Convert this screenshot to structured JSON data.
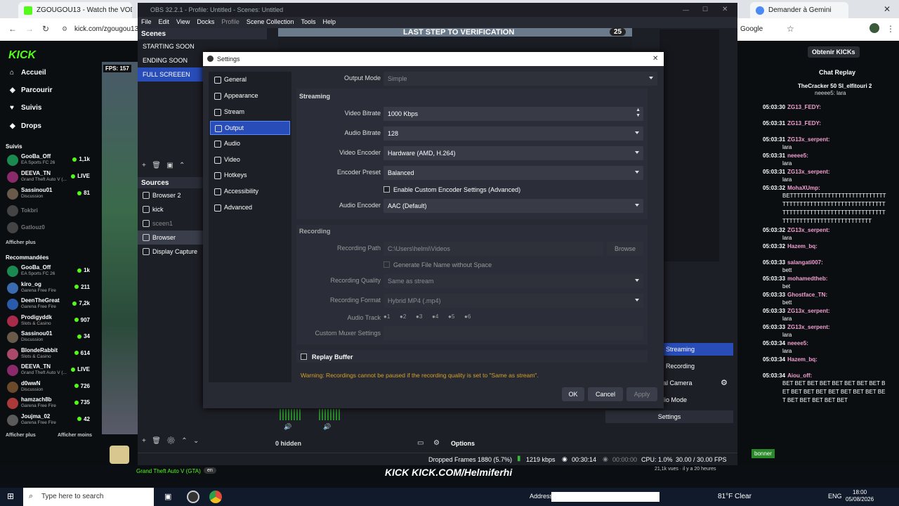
{
  "browser": {
    "tabs": [
      "ZGOUGOU13 - Watch the VOD",
      "Demander à Gemini"
    ],
    "url": "kick.com/zgougou13",
    "google_label": "Google",
    "obtain_label": "Obtenir KICKs"
  },
  "kick": {
    "logo": "KICK",
    "nav": [
      "Accueil",
      "Parcourir",
      "Suivis",
      "Drops"
    ],
    "followed_title": "Suivis",
    "followed": [
      {
        "name": "GooBa_Off",
        "game": "EA Sports FC 26",
        "viewers": "1,1k",
        "color": "#1a8a50"
      },
      {
        "name": "DEEVA_TN",
        "game": "Grand Theft Auto V (...",
        "viewers": "LIVE",
        "color": "#8a2a6a"
      },
      {
        "name": "Sassinou01",
        "game": "Discussion",
        "viewers": "81",
        "color": "#6a5a4a"
      },
      {
        "name": "Tokbri",
        "game": "",
        "viewers": "",
        "color": "#444"
      },
      {
        "name": "Gatlouz0",
        "game": "",
        "viewers": "",
        "color": "#444"
      }
    ],
    "show_more": "Afficher plus",
    "recommended_title": "Recommandées",
    "recommended": [
      {
        "name": "GooBa_Off",
        "game": "EA Sports FC 26",
        "viewers": "1k",
        "color": "#1a8a50"
      },
      {
        "name": "kiro_og",
        "game": "Garena Free Fire",
        "viewers": "211",
        "color": "#3a6ab0"
      },
      {
        "name": "DeenTheGreat",
        "game": "Garena Free Fire",
        "viewers": "7,2k",
        "color": "#2a5aaa"
      },
      {
        "name": "Prodigyddk",
        "game": "Slots & Casino",
        "viewers": "907",
        "color": "#aa2a4a"
      },
      {
        "name": "Sassinou01",
        "game": "Discussion",
        "viewers": "34",
        "color": "#6a5a4a"
      },
      {
        "name": "BlondeRabbit",
        "game": "Slots & Casino",
        "viewers": "614",
        "color": "#aa4a6a"
      },
      {
        "name": "DEEVA_TN",
        "game": "Grand Theft Auto V (...",
        "viewers": "LIVE",
        "color": "#8a2a6a"
      },
      {
        "name": "d0wwN",
        "game": "Discussion",
        "viewers": "726",
        "color": "#6a4a2a"
      },
      {
        "name": "hamzach8b",
        "game": "Garena Free Fire",
        "viewers": "735",
        "color": "#aa3a3a"
      },
      {
        "name": "Joujma_02",
        "game": "Garena Free Fire",
        "viewers": "42",
        "color": "#5a5a5a"
      }
    ],
    "show_more2": "Afficher plus",
    "show_less": "Afficher moins",
    "bottom_game": "Grand Theft Auto V (GTA)",
    "bottom_lang": "en",
    "banner": "KICK KICK.COM/Helmiferhi",
    "fps": "FPS: 157"
  },
  "obs": {
    "title": "OBS 32.2.1 - Profile: Untitled - Scenes: Untitled",
    "menu": [
      "File",
      "Edit",
      "View",
      "Docks",
      "Profile",
      "Scene Collection",
      "Tools",
      "Help"
    ],
    "preview_overlay": "LAST STEP TO VERIFICATION",
    "preview_count": "25",
    "scenes_title": "Scenes",
    "scenes": [
      "STARTING SOON",
      "ENDING SOON",
      "FULL SCREEEN"
    ],
    "sources_title": "Sources",
    "sources": [
      "Browser 2",
      "kick",
      "sceen1",
      "Browser",
      "Display Capture"
    ],
    "hidden": "0 hidden",
    "options": "Options",
    "controls": [
      "Streaming",
      "Recording",
      "al Camera",
      "lio Mode",
      "Settings"
    ],
    "status": {
      "dropped": "Dropped Frames 1880 (5.7%)",
      "bitrate": "1219 kbps",
      "stream_time": "00:30:14",
      "rec_time": "00:00:00",
      "cpu": "CPU: 1.0%",
      "fps": "30.00 / 30.00 FPS"
    }
  },
  "settings": {
    "title": "Settings",
    "nav": [
      "General",
      "Appearance",
      "Stream",
      "Output",
      "Audio",
      "Video",
      "Hotkeys",
      "Accessibility",
      "Advanced"
    ],
    "selected": "Output",
    "output_mode_label": "Output Mode",
    "output_mode": "Simple",
    "streaming_title": "Streaming",
    "video_bitrate_label": "Video Bitrate",
    "video_bitrate": "1000 Kbps",
    "audio_bitrate_label": "Audio Bitrate",
    "audio_bitrate": "128",
    "video_encoder_label": "Video Encoder",
    "video_encoder": "Hardware (AMD, H.264)",
    "encoder_preset_label": "Encoder Preset",
    "encoder_preset": "Balanced",
    "custom_encoder": "Enable Custom Encoder Settings (Advanced)",
    "audio_encoder_label": "Audio Encoder",
    "audio_encoder": "AAC (Default)",
    "recording_title": "Recording",
    "recording_path_label": "Recording Path",
    "recording_path": "C:\\Users\\helmi\\Videos",
    "browse": "Browse",
    "gen_filename": "Generate File Name without Space",
    "recording_quality_label": "Recording Quality",
    "recording_quality": "Same as stream",
    "recording_format_label": "Recording Format",
    "recording_format": "Hybrid MP4 (.mp4)",
    "audio_track_label": "Audio Track",
    "tracks": [
      "1",
      "2",
      "3",
      "4",
      "5",
      "6"
    ],
    "muxer_label": "Custom Muxer Settings",
    "replay_buffer": "Replay Buffer",
    "warning": "Warning: Recordings cannot be paused if the recording quality is set to \"Same as stream\".",
    "ok": "OK",
    "cancel": "Cancel",
    "apply": "Apply"
  },
  "chat": {
    "title": "Chat Replay",
    "header_users": "TheCracker 50   SI_elfitouri 2",
    "header_text": "neeee5: lara",
    "messages": [
      {
        "time": "05:03:30",
        "user": "ZG13_FEDY:",
        "text": ""
      },
      {
        "time": "05:03:31",
        "user": "ZG13_FEDY:",
        "text": ""
      },
      {
        "time": "05:03:31",
        "user": "ZG13x_serpent:",
        "text": "lara"
      },
      {
        "time": "05:03:31",
        "user": "neeee5:",
        "text": "lara"
      },
      {
        "time": "05:03:31",
        "user": "ZG13x_serpent:",
        "text": "lara"
      },
      {
        "time": "05:03:32",
        "user": "MohaXUmp:",
        "text": "BETTTTTTTTTTTTTTTTTTTTTTTTTTTTTTTTTTTTTTTTTTTTTTTTTTTTTTTTTTTTTTTTTTTTTTTTTTTTTTTTTTTTTTTTTTTTTTTTTTTTTTTTTTTTTTTTTT"
      },
      {
        "time": "05:03:32",
        "user": "ZG13x_serpent:",
        "text": "lara"
      },
      {
        "time": "05:03:32",
        "user": "Hazem_bq:",
        "text": ""
      },
      {
        "time": "05:03:33",
        "user": "salangati007:",
        "text": "bett"
      },
      {
        "time": "05:03:33",
        "user": "mohamedtheb:",
        "text": "bet"
      },
      {
        "time": "05:03:33",
        "user": "Ghostface_TN:",
        "text": "bett"
      },
      {
        "time": "05:03:33",
        "user": "ZG13x_serpent:",
        "text": "lara"
      },
      {
        "time": "05:03:33",
        "user": "ZG13x_serpent:",
        "text": "lara"
      },
      {
        "time": "05:03:34",
        "user": "neeee5:",
        "text": "lara"
      },
      {
        "time": "05:03:34",
        "user": "Hazem_bq:",
        "text": ""
      },
      {
        "time": "05:03:34",
        "user": "Aiou_off:",
        "text": "BET BET BET BET BET BET BET BET BET BET BET BET BET BET BET BET BET BET BET BET BET BET"
      }
    ],
    "bottom_stats": "21,1k vues · il y a 20 heures",
    "subscribe": "bonner"
  },
  "taskbar": {
    "search": "Type here to search",
    "address_label": "Address",
    "weather": "81°F  Clear",
    "lang": "ENG",
    "time": "18:00",
    "date": "05/08/2026"
  }
}
